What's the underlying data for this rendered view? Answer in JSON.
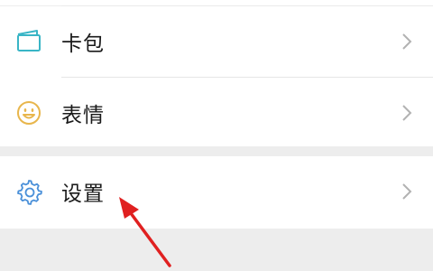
{
  "menu": {
    "items": [
      {
        "label": "卡包",
        "icon": "card-wallet-icon",
        "icon_color": "#39b5c6"
      },
      {
        "label": "表情",
        "icon": "smiley-face-icon",
        "icon_color": "#e8b64c"
      },
      {
        "label": "设置",
        "icon": "gear-icon",
        "icon_color": "#4a90d9"
      }
    ]
  },
  "colors": {
    "background": "#ededed",
    "row_background": "#ffffff",
    "chevron": "#b2b2b2",
    "annotation_arrow": "#e02020"
  }
}
